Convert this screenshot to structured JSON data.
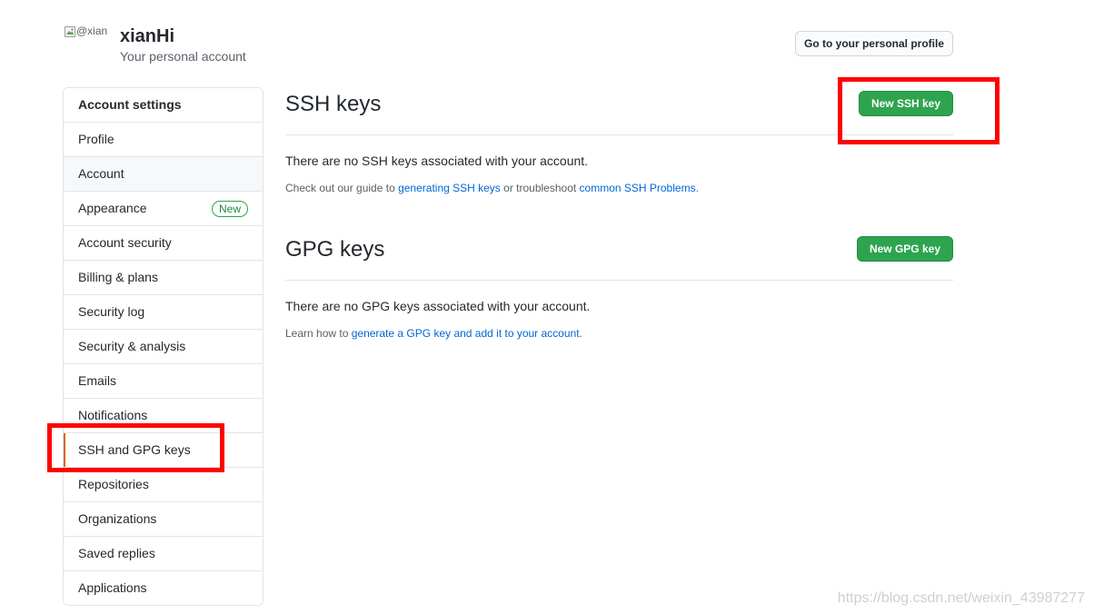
{
  "header": {
    "avatar_alt": "@xianHi",
    "username": "xianHi",
    "subtitle": "Your personal account",
    "profile_button": "Go to your personal profile"
  },
  "sidebar": {
    "heading": "Account settings",
    "items": [
      {
        "label": "Profile"
      },
      {
        "label": "Account"
      },
      {
        "label": "Appearance",
        "badge": "New"
      },
      {
        "label": "Account security"
      },
      {
        "label": "Billing & plans"
      },
      {
        "label": "Security log"
      },
      {
        "label": "Security & analysis"
      },
      {
        "label": "Emails"
      },
      {
        "label": "Notifications"
      },
      {
        "label": "SSH and GPG keys"
      },
      {
        "label": "Repositories"
      },
      {
        "label": "Organizations"
      },
      {
        "label": "Saved replies"
      },
      {
        "label": "Applications"
      }
    ]
  },
  "ssh": {
    "title": "SSH keys",
    "button": "New SSH key",
    "empty": "There are no SSH keys associated with your account.",
    "help_prefix": "Check out our guide to ",
    "help_link1": "generating SSH keys",
    "help_middle": " or troubleshoot ",
    "help_link2": "common SSH Problems",
    "help_suffix": "."
  },
  "gpg": {
    "title": "GPG keys",
    "button": "New GPG key",
    "empty": "There are no GPG keys associated with your account.",
    "help_prefix": "Learn how to ",
    "help_link": "generate a GPG key and add it to your account",
    "help_suffix": "."
  },
  "watermark": "https://blog.csdn.net/weixin_43987277",
  "colors": {
    "accent_green": "#2ea44f",
    "link_blue": "#0366d6",
    "selected_bar": "#e36209",
    "annotation_red": "#ff0000"
  }
}
